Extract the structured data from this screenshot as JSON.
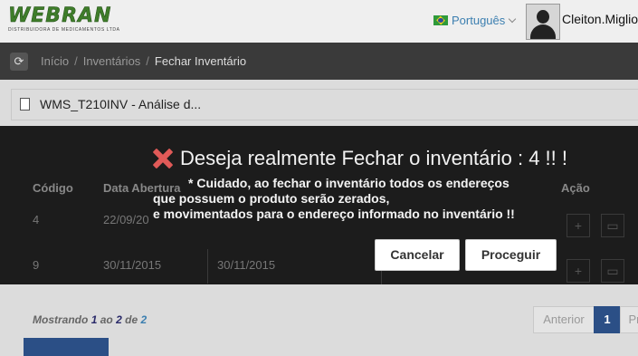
{
  "header": {
    "logo_text": "WEBRAN",
    "logo_subtitle": "DISTRIBUIDORA DE MEDICAMENTOS LTDA",
    "language": "Português",
    "username": "Cleiton.Miglio"
  },
  "breadcrumb": {
    "items": [
      "Início",
      "Inventários",
      "Fechar Inventário"
    ],
    "separator": "/"
  },
  "panel": {
    "title": "WMS_T210INV - Análise d..."
  },
  "table": {
    "headers": {
      "codigo": "Código",
      "data_abertura": "Data Abertura",
      "acao": "Ação"
    },
    "rows": [
      {
        "codigo": "4",
        "data_abertura": "22/09/20",
        "data2": ""
      },
      {
        "codigo": "9",
        "data_abertura": "30/11/2015",
        "data2": "30/11/2015"
      }
    ]
  },
  "footer": {
    "showing_label": "Mostrando",
    "from": "1",
    "to_label": "ao",
    "to": "2",
    "of_label": "de",
    "total": "2",
    "prev_label": "Anterior",
    "current_page": "1",
    "next_label": "Pr"
  },
  "dialog": {
    "title": "Deseja realmente Fechar o inventário : 4 !! !",
    "message_lines": [
      "* Cuidado, ao fechar o inventário todos os endereços",
      "que possuem o produto serão zerados,",
      "e movimentados para o endereço informado no inventário !!"
    ],
    "cancel_label": "Cancelar",
    "proceed_label": "Proceguir",
    "icon": "close-x-icon",
    "icon_color": "#e05a58"
  }
}
